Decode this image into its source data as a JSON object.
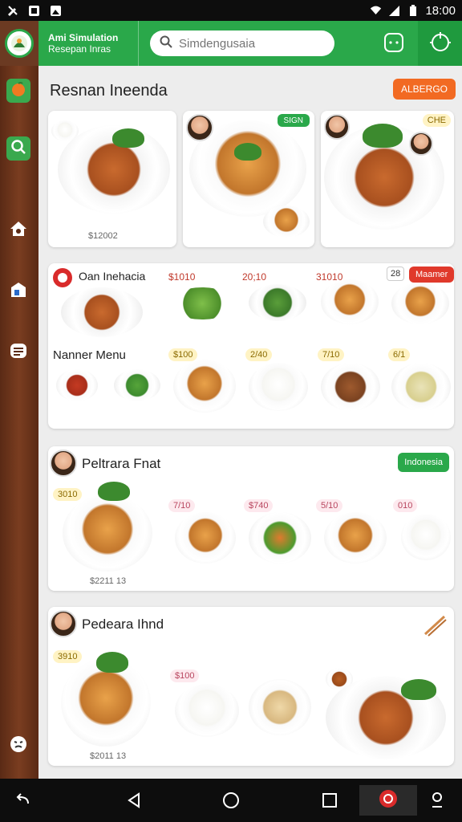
{
  "status_bar": {
    "time": "18:00"
  },
  "header": {
    "app_title_line1": "Ami Simulation",
    "app_title_line2": "Resepan Inras",
    "search_placeholder": "Simdengusaia"
  },
  "main": {
    "page_title": "Resnan Ineenda",
    "top_badge": "ALBERGO",
    "gallery": {
      "cards": [
        {
          "caption": "$12002",
          "badge": ""
        },
        {
          "caption": "",
          "badge": "SIGN"
        },
        {
          "caption": "",
          "badge": "CHE"
        }
      ]
    },
    "menu_card": {
      "title": "Oan Inehacia",
      "subtitle": "Nanner Menu",
      "badge_num": "28",
      "badge_red": "Maamer",
      "row1_prices": [
        "$1010",
        "20;10",
        "31010"
      ],
      "row2_prices": [
        "$100",
        "2/40",
        "7/10",
        "6/1"
      ]
    },
    "section1": {
      "title": "Peltrara Fnat",
      "badge": "Indonesia",
      "price_top": "3010",
      "prices": [
        "7/10",
        "$740",
        "5/10",
        "010"
      ],
      "caption": "$2211 13"
    },
    "section2": {
      "title": "Pedeara Ihnd",
      "price_top": "3910",
      "price_mid": "$100",
      "caption": "$2011 13"
    }
  },
  "colors": {
    "header_green": "#2aa84a",
    "sidebar_brown": "#6b3a22",
    "accent_orange": "#f26a22",
    "accent_red": "#e0392b"
  }
}
